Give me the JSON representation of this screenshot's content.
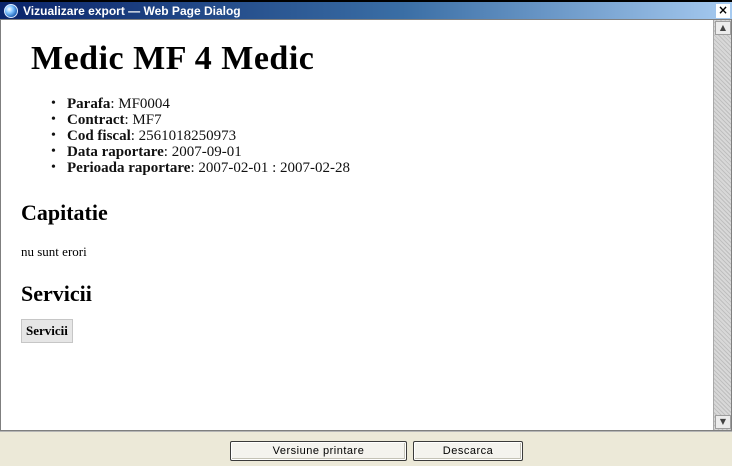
{
  "window": {
    "title": "Vizualizare export — Web Page Dialog",
    "close_glyph": "×",
    "app_icon": "ie-globe-icon"
  },
  "report": {
    "heading": "Medic MF 4 Medic",
    "info": [
      {
        "label": "Parafa",
        "value": "MF0004"
      },
      {
        "label": "Contract",
        "value": "MF7"
      },
      {
        "label": "Cod fiscal",
        "value": "2561018250973"
      },
      {
        "label": "Data raportare",
        "value": "2007-09-01"
      },
      {
        "label": "Perioada raportare",
        "value": "2007-02-01 : 2007-02-28"
      }
    ],
    "capitatie": {
      "heading": "Capitatie",
      "text": "nu sunt erori"
    },
    "servicii": {
      "heading": "Servicii",
      "button_label": "Servicii"
    }
  },
  "scrollbar": {
    "up_glyph": "▲",
    "down_glyph": "▼"
  },
  "footer": {
    "print_button_label": "Versiune printare",
    "download_button_label": "Descarca"
  }
}
